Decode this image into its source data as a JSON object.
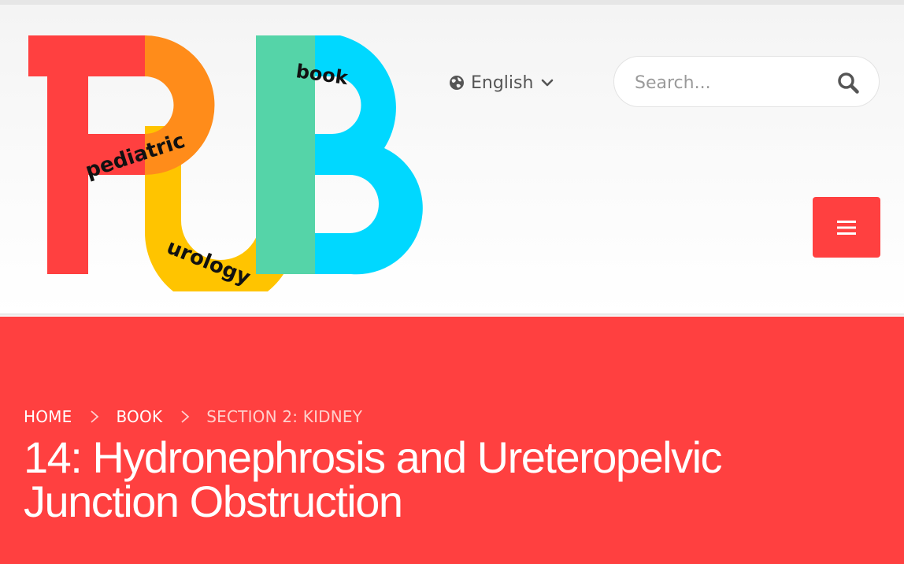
{
  "logo": {
    "letters": [
      "P",
      "U",
      "B"
    ],
    "words": [
      "pediatric",
      "urology",
      "book"
    ],
    "colors": {
      "red": "#ff4040",
      "orange": "#ff8c1a",
      "yellow": "#ffc400",
      "green": "#55d4a8",
      "cyan": "#00d8ff",
      "text": "#111111"
    }
  },
  "language": {
    "label": "English",
    "icon": "globe-icon",
    "dropdown_icon": "chevron-down-icon"
  },
  "search": {
    "placeholder": "Search...",
    "value": "",
    "icon": "search-icon"
  },
  "menu": {
    "icon": "hamburger-icon"
  },
  "breadcrumb": {
    "items": [
      {
        "label": "HOME"
      },
      {
        "label": "BOOK"
      },
      {
        "label": "SECTION 2: KIDNEY"
      }
    ],
    "separator_icon": "chevron-right-icon"
  },
  "page": {
    "title": "14: Hydronephrosis and Ureteropelvic Junction Obstruction"
  },
  "colors": {
    "accent": "#ff4040",
    "hero_text": "#ffffff",
    "breadcrumb_current": "#ffd0cc"
  }
}
